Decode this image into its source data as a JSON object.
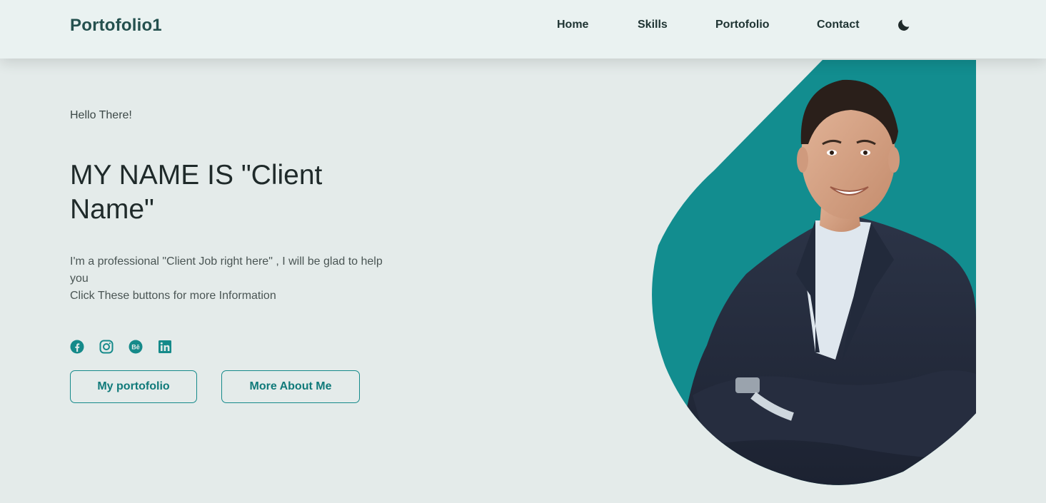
{
  "header": {
    "logo": "Portofolio1",
    "nav": [
      {
        "label": "Home"
      },
      {
        "label": "Skills"
      },
      {
        "label": "Portofolio"
      },
      {
        "label": "Contact"
      }
    ],
    "theme_icon": "moon-icon"
  },
  "hero": {
    "greeting": "Hello There!",
    "title": "MY NAME IS \"Client Name\"",
    "description_line1": "I'm a professional \"Client Job right here\" , I will be glad to help you",
    "description_line2": "Click These buttons for more Information",
    "social_icons": [
      "facebook-icon",
      "instagram-icon",
      "behance-icon",
      "linkedin-icon"
    ],
    "buttons": {
      "portfolio": "My portofolio",
      "about": "More About Me"
    }
  },
  "colors": {
    "accent": "#158a8a",
    "background": "#e4ebea",
    "header_bg": "#eaf2f1",
    "text_dark": "#1f2a2a"
  }
}
